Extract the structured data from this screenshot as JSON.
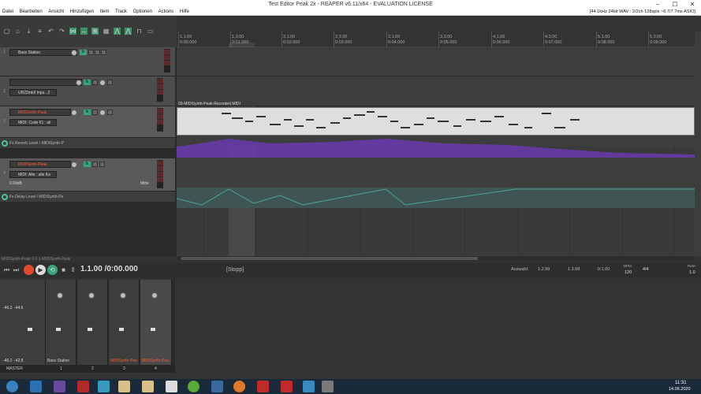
{
  "window": {
    "title": "Test Editor Peak 2x - REAPER v6.11/x64 - EVALUATION LICENSE",
    "status_right": "[44.1kHz 24bit WAV : 2/2ch 128spls ~6.7/7.7ms ASIO]"
  },
  "menu": {
    "items": [
      "Datei",
      "Bearbeiten",
      "Ansicht",
      "Hinzufügen",
      "Item",
      "Track",
      "Optionen",
      "Actions",
      "Hilfe"
    ]
  },
  "tracks": [
    {
      "num": "1",
      "name": "Bass Station"
    },
    {
      "num": "2",
      "name": "",
      "input": "UR22mkII Inpu...2"
    },
    {
      "num": "3",
      "name": "MIDISynth-Peak",
      "input": "MIDI: Code 61 : all"
    },
    {
      "num": "4",
      "name": "MIDISynth-Peak",
      "input": "MIDI: Alle : alle Ka",
      "vol": "0.00dB",
      "pan": "Mitte"
    }
  ],
  "envelopes": [
    {
      "label": "Fx Reverb Level / MIDISynth-P"
    },
    {
      "label": "Fx Delay Level / MIDISynth-Pe"
    }
  ],
  "ruler": {
    "marks": [
      "1.1.00",
      "1.3.00",
      "2.1.00",
      "2.3.00",
      "3.1.00",
      "3.3.00",
      "4.1.00",
      "4.3.00",
      "5.1.00",
      "5.3.00"
    ],
    "times": [
      "0:00.000",
      "0:01.000",
      "0:02.000",
      "0:03.000",
      "0:04.000",
      "0:05.000",
      "0:06.000",
      "0:07.000",
      "0:08.000",
      "0:09.000"
    ]
  },
  "midi_item": {
    "label": "03-MIDISynth-Peak-Recorded MIDI"
  },
  "transport": {
    "position": "1.1.00 /0:00.000",
    "state": "[Stopp]",
    "selection_label": "Auswahl:",
    "sel_start": "1.2.99",
    "sel_end": "1.3.99",
    "sel_len": "0:1.00",
    "bpm_label": "BPM",
    "bpm": "120",
    "time_sig": "4/4",
    "rate_label": "Rate:",
    "rate": "1.0"
  },
  "mixer": {
    "strips": [
      {
        "name": "MASTER",
        "num": ""
      },
      {
        "name": "Bass Station",
        "num": "1"
      },
      {
        "name": "",
        "num": "2"
      },
      {
        "name": "MIDISynth-Pea",
        "num": "3"
      },
      {
        "name": "MIDISynth-Pea",
        "num": "4"
      }
    ],
    "master_levels": [
      "-46.2",
      "-44.6"
    ],
    "master_bottom": [
      "-46.2",
      "-42.8"
    ]
  },
  "toolbar_status": "MIDISynth-Peak: FX 1 MIDISynth-Peak",
  "taskbar": {
    "time": "11:31",
    "date": "14.06.2020"
  }
}
